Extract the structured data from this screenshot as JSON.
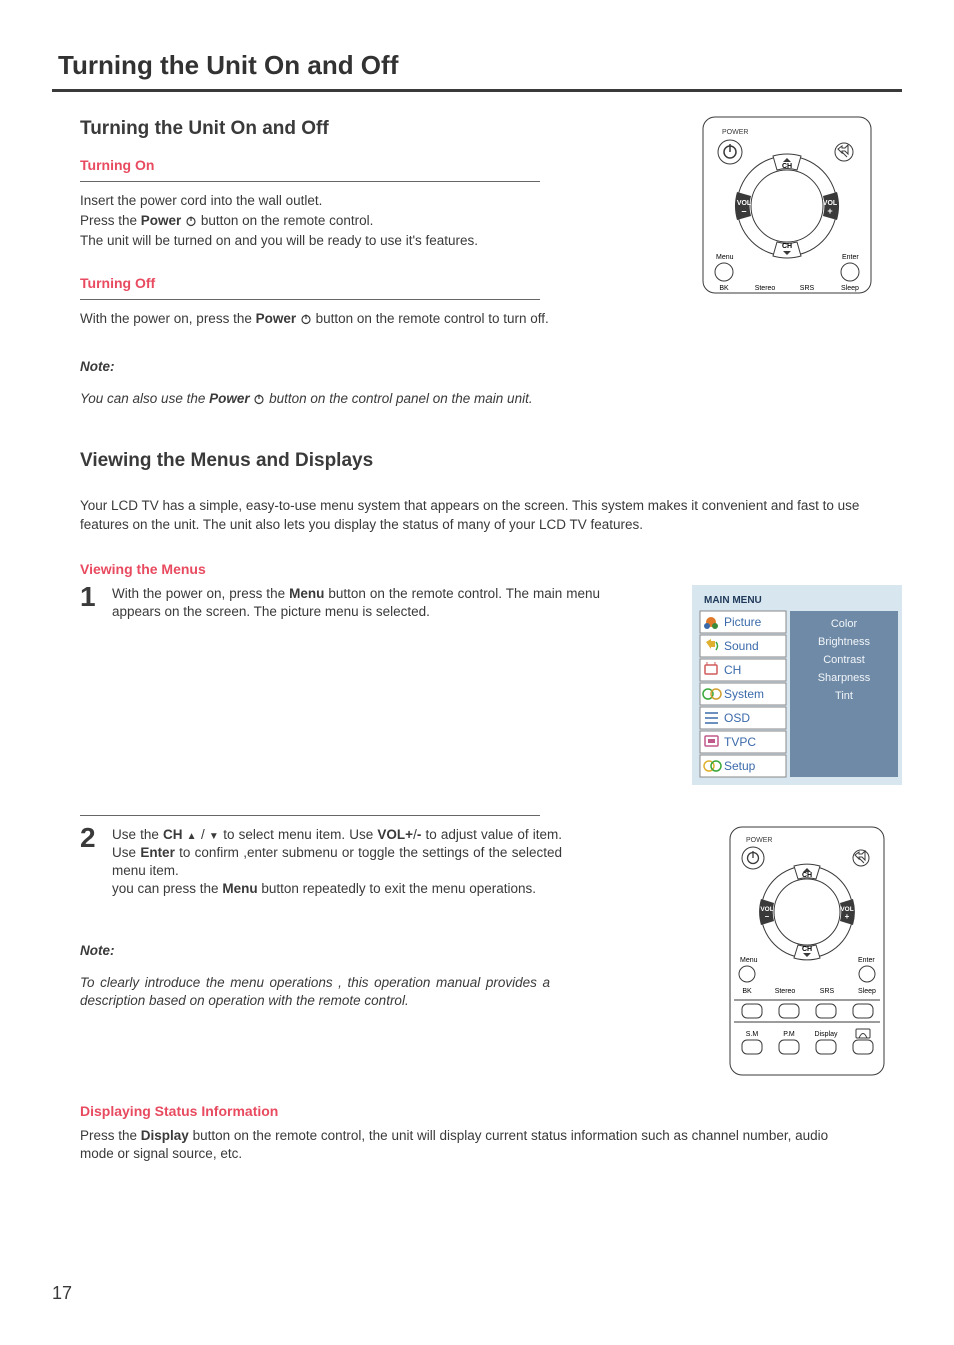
{
  "chapter_title": "Turning the Unit On and Off",
  "section1": {
    "heading": "Turning the Unit On and Off",
    "on_heading": "Turning On",
    "on_line1": "Insert the power cord into the wall outlet.",
    "on_line2a": "Press the ",
    "on_line2b": "Power",
    "on_line2c": " button on the remote control.",
    "on_line3": "The unit will be turned on and you will be ready to use it's features.",
    "off_heading": "Turning Off",
    "off_line_a": "With the power on, press the ",
    "off_line_b": "Power",
    "off_line_c": " button on the remote control to turn off.",
    "note_label": "Note:",
    "note_body_a": "You can also use the ",
    "note_body_b": "Power",
    "note_body_c": " button on the control panel on the main unit."
  },
  "section2": {
    "heading": "Viewing the Menus and Displays",
    "intro": "Your LCD TV has a simple, easy-to-use menu system that appears on the screen. This system makes it convenient and fast to use features on the unit. The unit also lets you display the status of many of your LCD TV features.",
    "view_heading": "Viewing the Menus",
    "step1_num": "1",
    "step1_a": "With the power on, press the ",
    "step1_b": "Menu",
    "step1_c": " button on the remote control. The main menu appears on the screen. The picture menu is selected.",
    "step2_num": "2",
    "step2_a": "Use the ",
    "step2_b": "CH",
    "step2_c": " to select menu item. Use ",
    "step2_d": "VOL+",
    "step2_e": "/",
    "step2_f": "-",
    "step2_g": " to adjust value  of item. Use ",
    "step2_h": "Enter",
    "step2_i": " to confirm ,enter submenu or toggle the settings of the selected menu item.",
    "step2_j": "you can press the ",
    "step2_k": "Menu",
    "step2_l": " button repeatedly to exit the menu operations.",
    "note2_label": "Note:",
    "note2_body": "To clearly introduce the menu operations , this operation manual provides a description based on operation with the remote control.",
    "disp_heading": "Displaying Status Information",
    "disp_body_a": "Press the ",
    "disp_body_b": "Display",
    "disp_body_c": " button on the remote control, the unit will display current status information such as channel number, audio mode or signal source, etc."
  },
  "remote": {
    "power": "POWER",
    "ch": "CH",
    "vol": "VOL",
    "minus": "–",
    "plus": "+",
    "menu": "Menu",
    "enter": "Enter",
    "bk": "BK",
    "stereo": "Stereo",
    "srs": "SRS",
    "sleep": "Sleep",
    "sm": "S.M",
    "pm": "P.M",
    "display": "Display"
  },
  "osd": {
    "title": "MAIN MENU",
    "items": [
      "Picture",
      "Sound",
      "CH",
      "System",
      "OSD",
      "TVPC",
      "Setup"
    ],
    "right": [
      "Color",
      "Brightness",
      "Contrast",
      "Sharpness",
      "Tint"
    ]
  },
  "page_number": "17"
}
